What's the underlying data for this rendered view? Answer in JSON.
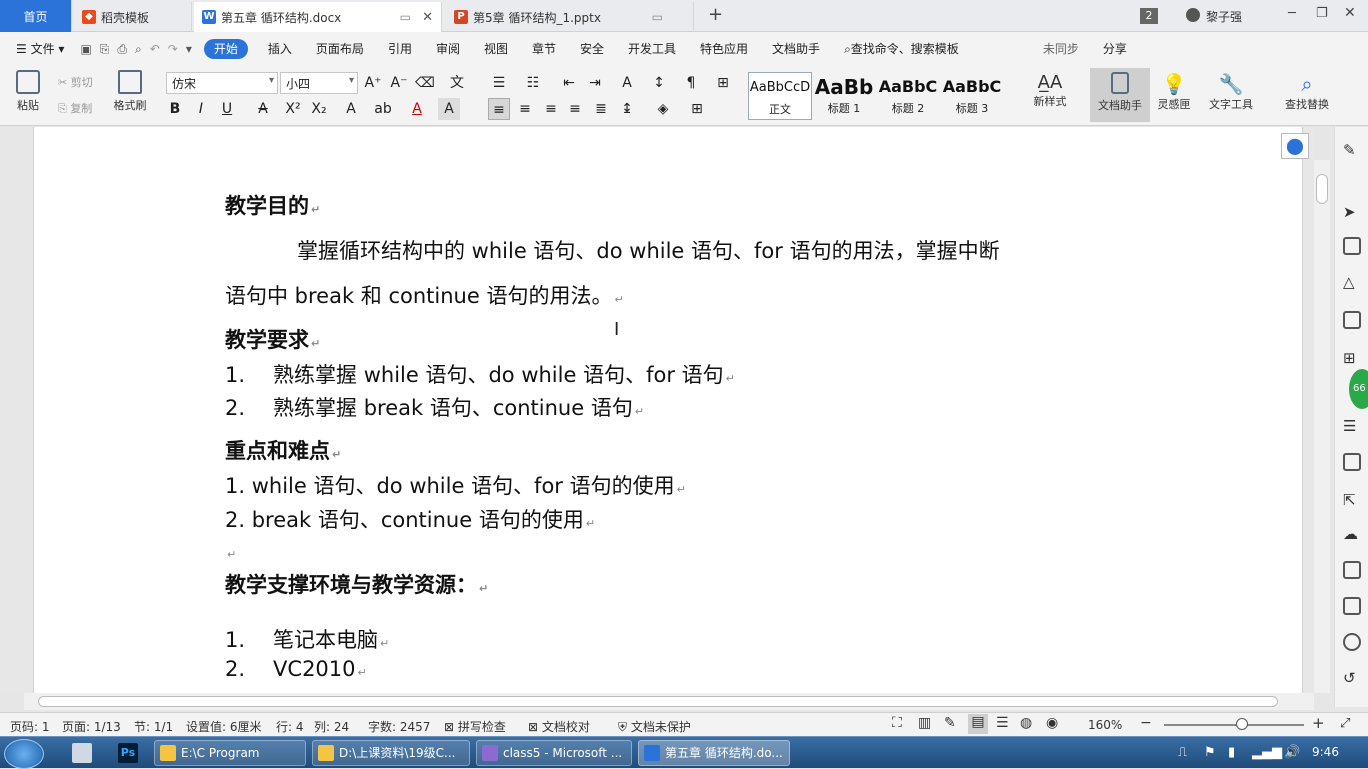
{
  "tabs": {
    "home": "首页",
    "t1": "稻壳模板",
    "t2": "第五章 循环结构.docx",
    "t3": "第5章 循环结构_1.pptx",
    "new": "+"
  },
  "title_right": {
    "badge": "2",
    "user": "黎子强"
  },
  "menu": {
    "file": "文件",
    "start": "开始",
    "insert": "插入",
    "layout": "页面布局",
    "ref": "引用",
    "review": "审阅",
    "view": "视图",
    "chapter": "章节",
    "security": "安全",
    "dev": "开发工具",
    "special": "特色应用",
    "assistant": "文档助手",
    "search": "查找命令、搜索模板",
    "sync": "未同步",
    "share": "分享"
  },
  "ribbon": {
    "paste": "粘贴",
    "cut": "剪切",
    "copy": "复制",
    "format_painter": "格式刷",
    "font": "仿宋",
    "size": "小四",
    "styles": [
      {
        "sample": "AaBbCcD",
        "label": "正文"
      },
      {
        "sample": "AaBb",
        "label": "标题 1"
      },
      {
        "sample": "AaBbC",
        "label": "标题 2"
      },
      {
        "sample": "AaBbC",
        "label": "标题 3"
      }
    ],
    "new_style": "新样式",
    "doc_assistant": "文档助手",
    "inspiration": "灵感匣",
    "text_tools": "文字工具",
    "find_replace": "查找替换"
  },
  "doc": {
    "h1": "教学目的",
    "p1a": "掌握循环结构中的 while 语句、do while 语句、for 语句的用法，掌握中断",
    "p1b": "语句中 break 和 continue 语句的用法。",
    "h2": "教学要求",
    "req1_num": "1.",
    "req1": "熟练掌握 while 语句、do while 语句、for 语句",
    "req2_num": "2.",
    "req2": "熟练掌握 break 语句、continue 语句",
    "h3": "重点和难点",
    "key1": "1.  while 语句、do while 语句、for 语句的使用",
    "key2": "2.  break 语句、continue 语句的使用",
    "h4": "教学支撑环境与教学资源：",
    "res1_num": "1.",
    "res1": "笔记本电脑",
    "res2_num": "2.",
    "res2": "VC2010",
    "mark": "↵"
  },
  "status": {
    "page_no": "页码: 1",
    "pages": "页面: 1/13",
    "section": "节: 1/1",
    "setting": "设置值: 6厘米",
    "row": "行: 4",
    "col": "列: 24",
    "words": "字数: 2457",
    "spell": "拼写检查",
    "proof": "文档校对",
    "protect": "文档未保护",
    "zoom": "160%"
  },
  "taskbar": {
    "t1": "E:\\C Program",
    "t2": "D:\\上课资料\\19级C...",
    "t3": "class5 - Microsoft ...",
    "t4": "第五章 循环结构.do...",
    "clock": "9:46"
  },
  "side_badge": "66"
}
